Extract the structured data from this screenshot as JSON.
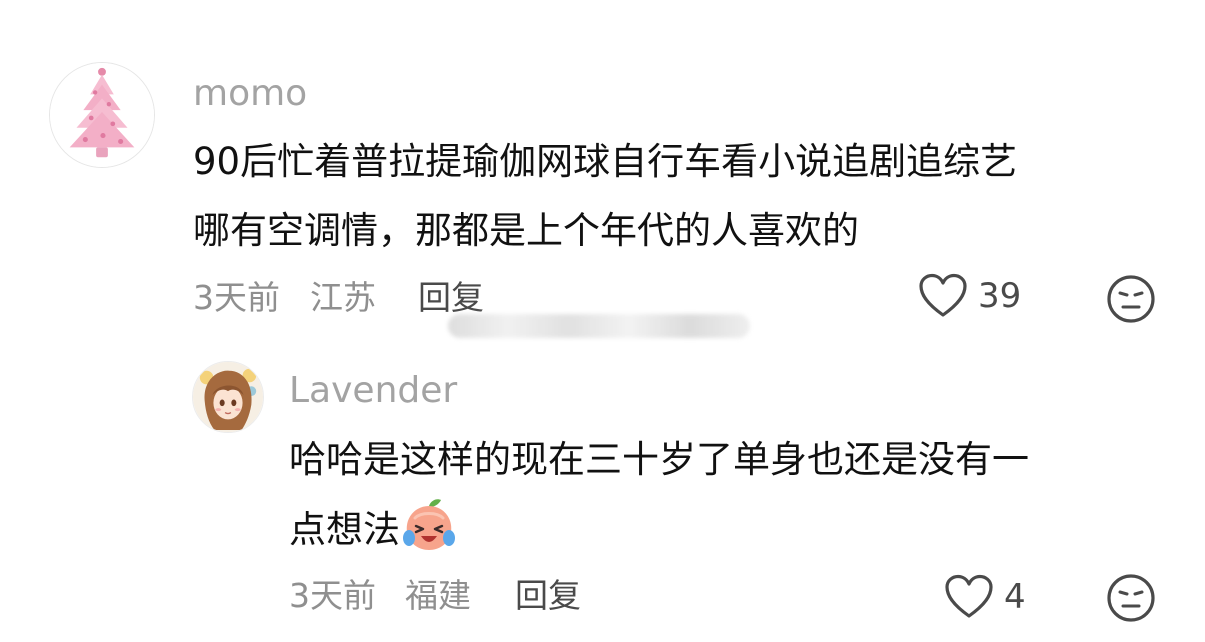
{
  "comments": [
    {
      "username": "momo",
      "text_lines": [
        "90后忙着普拉提瑜伽网球自行车看小说追剧追综艺",
        "哪有空调情，那都是上个年代的人喜欢的"
      ],
      "time": "3天前",
      "location": "江苏",
      "reply_label": "回复",
      "likes": "39",
      "avatar_icon": "pink-christmas-tree-icon",
      "reaction_icon": "neutral-face-icon"
    },
    {
      "username": "Lavender",
      "text_lines": [
        "哈哈是这样的现在三十岁了单身也还是没有一",
        "点想法"
      ],
      "inline_emoji": "laughing-crying-peach-emoji",
      "time": "3天前",
      "location": "福建",
      "reply_label": "回复",
      "likes": "4",
      "avatar_icon": "anime-girl-avatar-icon",
      "reaction_icon": "neutral-face-icon"
    }
  ],
  "colors": {
    "username": "#a3a3a3",
    "text": "#111111",
    "meta": "#8f8f8f",
    "icon": "#4a4a4a",
    "avatar_tree": "#f2a9c4"
  }
}
